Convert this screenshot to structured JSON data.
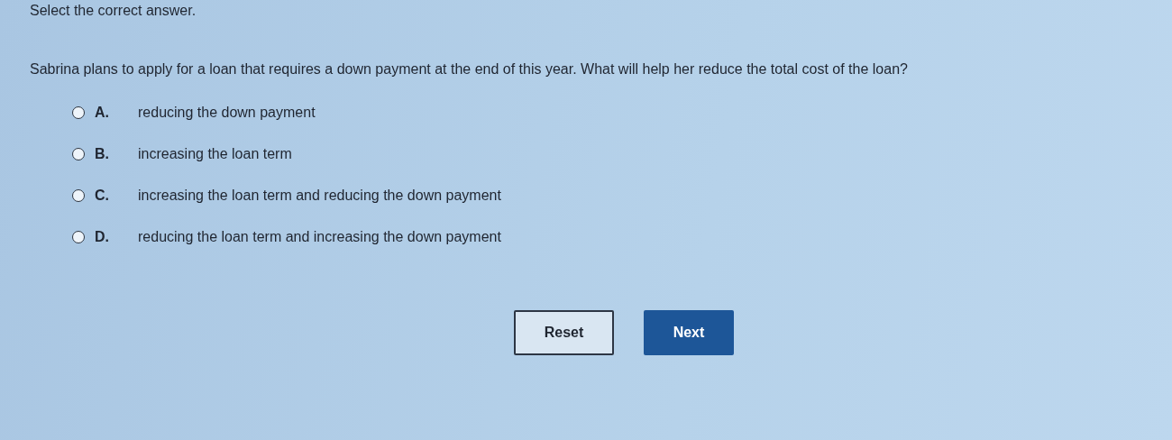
{
  "instruction": "Select the correct answer.",
  "question": "Sabrina plans to apply for a loan that requires a down payment at the end of this year. What will help her reduce the total cost of the loan?",
  "options": [
    {
      "letter": "A.",
      "text": "reducing the down payment",
      "selected": false
    },
    {
      "letter": "B.",
      "text": "increasing the loan term",
      "selected": false
    },
    {
      "letter": "C.",
      "text": "increasing the loan term and reducing the down payment",
      "selected": false
    },
    {
      "letter": "D.",
      "text": "reducing the loan term and increasing the down payment",
      "selected": false
    }
  ],
  "buttons": [
    {
      "label": "Reset",
      "kind": "secondary"
    },
    {
      "label": "Next",
      "kind": "primary"
    }
  ]
}
